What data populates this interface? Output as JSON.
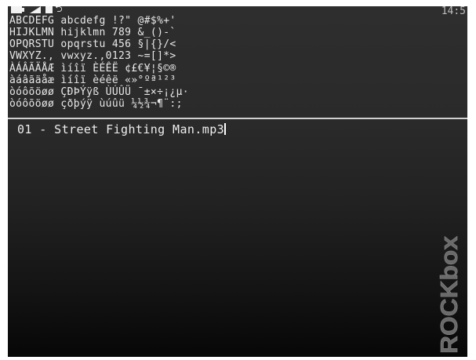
{
  "status_bar": {
    "battery_icon": "battery-icon",
    "volume_icon": "volume-icon",
    "playback_icon": "stop-icon",
    "repeat_icon": "repeat-icon",
    "repeat_glyph": "⮌",
    "clock": "14:5"
  },
  "font_preview": {
    "lines": [
      "ABCDEFG abcdefg !?\" @#$%+'",
      "HIJKLMN hijklmn 789 &_()-`",
      "OPQRSTU opqrstu 456 §|{}/<",
      "VWXYZ., vwxyz.,0123 ~=[]*>",
      "ÀÁÂÃÄÅÆ ìíîï ÈÉÊË ¢£€¥¦§©®",
      "àáâãäåæ ìíîï èéêë «»°ºª¹²³",
      "òóôõöøø ÇÐÞÝÿß ÙÚÛÜ ¯±×÷¡¿µ·",
      "òóôõöøø çðþýÿ ùúûü ¼½¾¬¶¨:;"
    ]
  },
  "editor": {
    "entry_text": "01 - Street Fighting Man.mp3"
  },
  "watermark": {
    "text": "ROCKbox"
  }
}
